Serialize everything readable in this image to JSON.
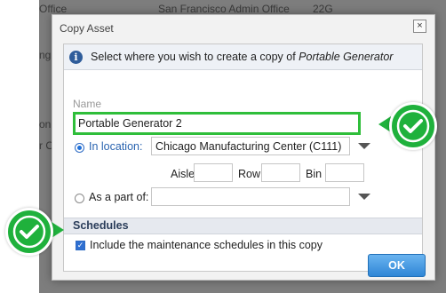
{
  "background": {
    "row1": {
      "name": "Office",
      "location": "San Francisco Admin Office",
      "value": "22G"
    },
    "fragments": [
      "ng F",
      "on F",
      "r Of"
    ]
  },
  "dialog": {
    "title": "Copy Asset",
    "close_glyph": "×",
    "info_prefix": "Select where you wish to create a copy of ",
    "info_asset": "Portable Generator",
    "name_label": "Name",
    "name_value": "Portable Generator 2",
    "in_location_label": "In location:",
    "in_location_value": "Chicago Manufacturing Center (C111)",
    "aisle_label": "Aisle",
    "row_label": "Row",
    "bin_label": "Bin",
    "as_part_of_label": "As a part of:",
    "as_part_of_value": "",
    "schedules_heading": "Schedules",
    "include_schedules_label": "Include the maintenance schedules in this copy",
    "ok_label": "OK"
  },
  "state": {
    "in_location_selected": true,
    "as_part_selected": false,
    "include_schedules_checked": true
  },
  "colors": {
    "highlight_green": "#1fb13c",
    "link_blue": "#2a64b0",
    "ok_blue": "#2f86d6"
  },
  "icons": [
    "info-icon",
    "close-icon",
    "dropdown-arrow-icon",
    "checkmark-badge-icon"
  ]
}
